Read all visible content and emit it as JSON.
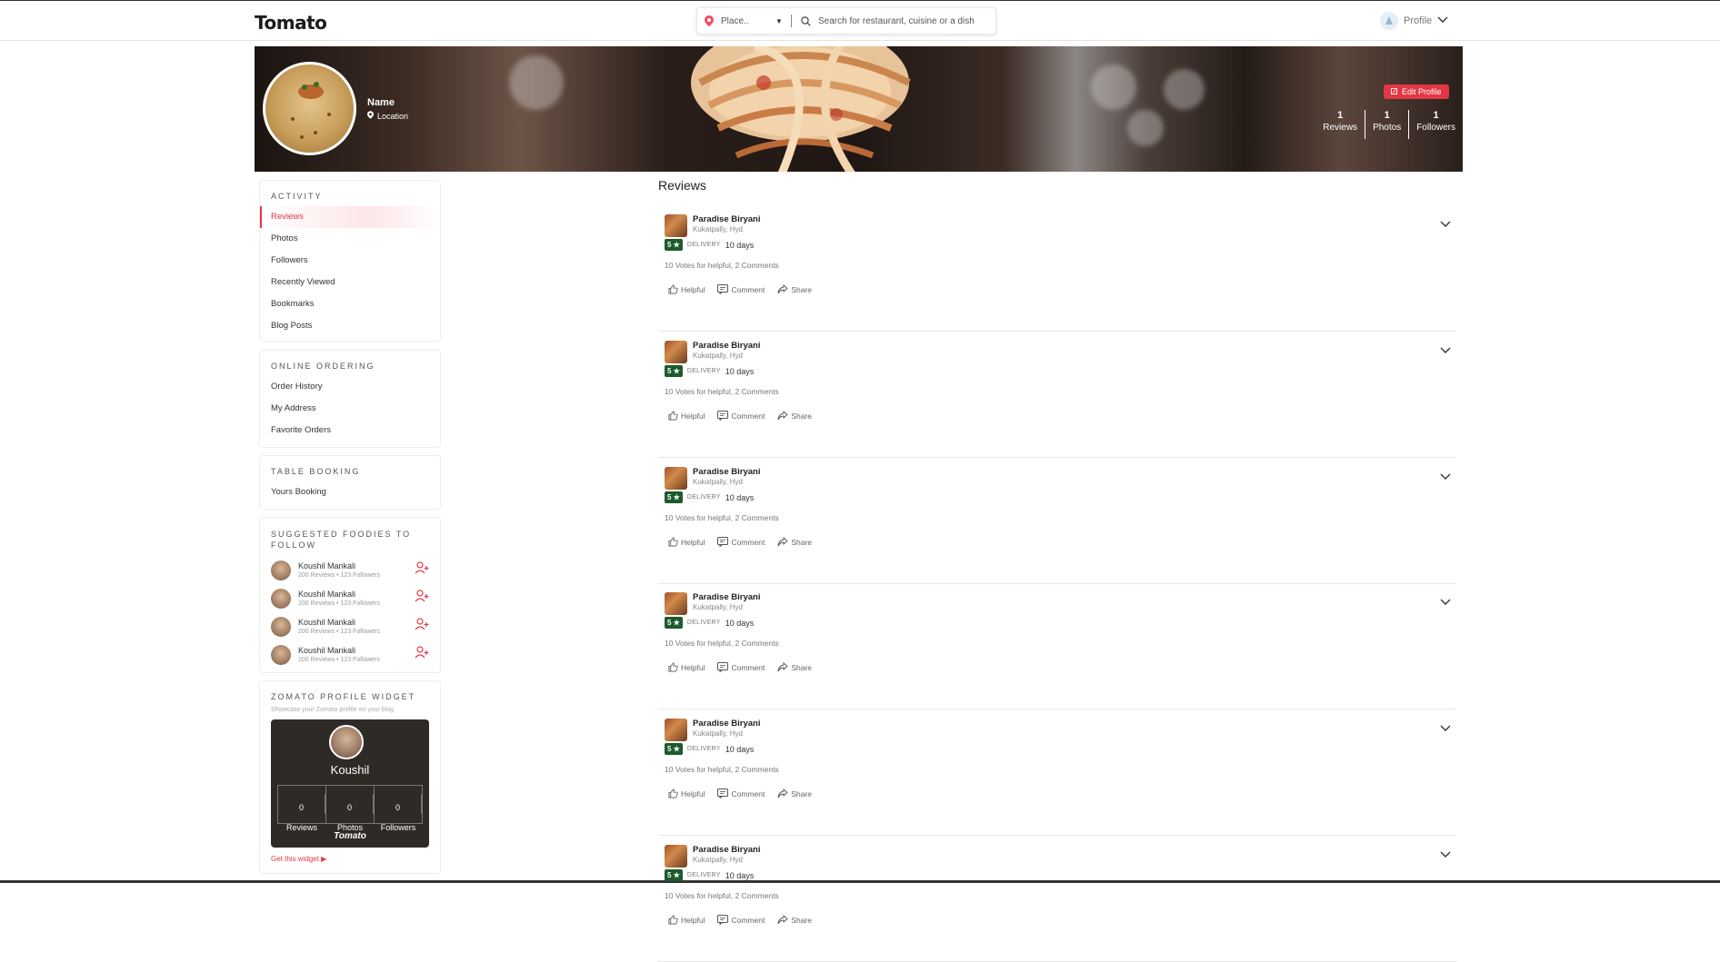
{
  "app": {
    "brand": "Tomato",
    "accent_color": "#e23744"
  },
  "search": {
    "place_placeholder": "Place..",
    "query_placeholder": "Search for restaurant, cuisine or a dish"
  },
  "header": {
    "profile_label": "Profile"
  },
  "banner": {
    "name": "Name",
    "location": "Location",
    "edit_label": "Edit Profile",
    "stats": [
      {
        "value": "1",
        "label": "Reviews"
      },
      {
        "value": "1",
        "label": "Photos"
      },
      {
        "value": "1",
        "label": "Followers"
      }
    ]
  },
  "sidebar": {
    "activity": {
      "title": "ACTIVITY",
      "items": [
        "Reviews",
        "Photos",
        "Followers",
        "Recently Viewed",
        "Bookmarks",
        "Blog Posts"
      ]
    },
    "online_ordering": {
      "title": "ONLINE ORDERING",
      "items": [
        "Order History",
        "My Address",
        "Favorite Orders"
      ]
    },
    "table_booking": {
      "title": "TABLE BOOKING",
      "items": [
        "Yours Booking"
      ]
    },
    "suggested": {
      "title": "SUGGESTED FOODIES TO FOLLOW",
      "foodies": [
        {
          "name": "Koushil Mankali",
          "reviews": "200 Reviews",
          "followers": "123 Followers"
        },
        {
          "name": "Koushil Mankali",
          "reviews": "200 Reviews",
          "followers": "123 Followers"
        },
        {
          "name": "Koushil Mankali",
          "reviews": "200 Reviews",
          "followers": "123 Followers"
        },
        {
          "name": "Koushil Mankali",
          "reviews": "200 Reviews",
          "followers": "123 Followers"
        }
      ]
    },
    "widget": {
      "title": "ZOMATO PROFILE WIDGET",
      "description": "Showcase your Zomato profile on your blog",
      "name": "Koushil",
      "stats": [
        {
          "value": "0",
          "label": "Reviews"
        },
        {
          "value": "0",
          "label": "Photos"
        },
        {
          "value": "0",
          "label": "Followers"
        }
      ],
      "brand": "Tomato",
      "get_link": "Get this widget"
    }
  },
  "reviews": {
    "title": "Reviews",
    "items": [
      {
        "restaurant": "Paradise Biryani",
        "location": "Kukatpally, Hyd",
        "rating": "5 ★",
        "tag": "DELIVERY",
        "time": "10 days",
        "votes": "10 Votes for helpful, 2 Comments"
      },
      {
        "restaurant": "Paradise Biryani",
        "location": "Kukatpally, Hyd",
        "rating": "5 ★",
        "tag": "DELIVERY",
        "time": "10 days",
        "votes": "10 Votes for helpful, 2 Comments"
      },
      {
        "restaurant": "Paradise Biryani",
        "location": "Kukatpally, Hyd",
        "rating": "5 ★",
        "tag": "DELIVERY",
        "time": "10 days",
        "votes": "10 Votes for helpful, 2 Comments"
      },
      {
        "restaurant": "Paradise Biryani",
        "location": "Kukatpally, Hyd",
        "rating": "5 ★",
        "tag": "DELIVERY",
        "time": "10 days",
        "votes": "10 Votes for helpful, 2 Comments"
      },
      {
        "restaurant": "Paradise Biryani",
        "location": "Kukatpally, Hyd",
        "rating": "5 ★",
        "tag": "DELIVERY",
        "time": "10 days",
        "votes": "10 Votes for helpful, 2 Comments"
      },
      {
        "restaurant": "Paradise Biryani",
        "location": "Kukatpally, Hyd",
        "rating": "5 ★",
        "tag": "DELIVERY",
        "time": "10 days",
        "votes": "10 Votes for helpful, 2 Comments"
      }
    ],
    "actions": {
      "helpful": "Helpful",
      "comment": "Comment",
      "share": "Share"
    }
  }
}
